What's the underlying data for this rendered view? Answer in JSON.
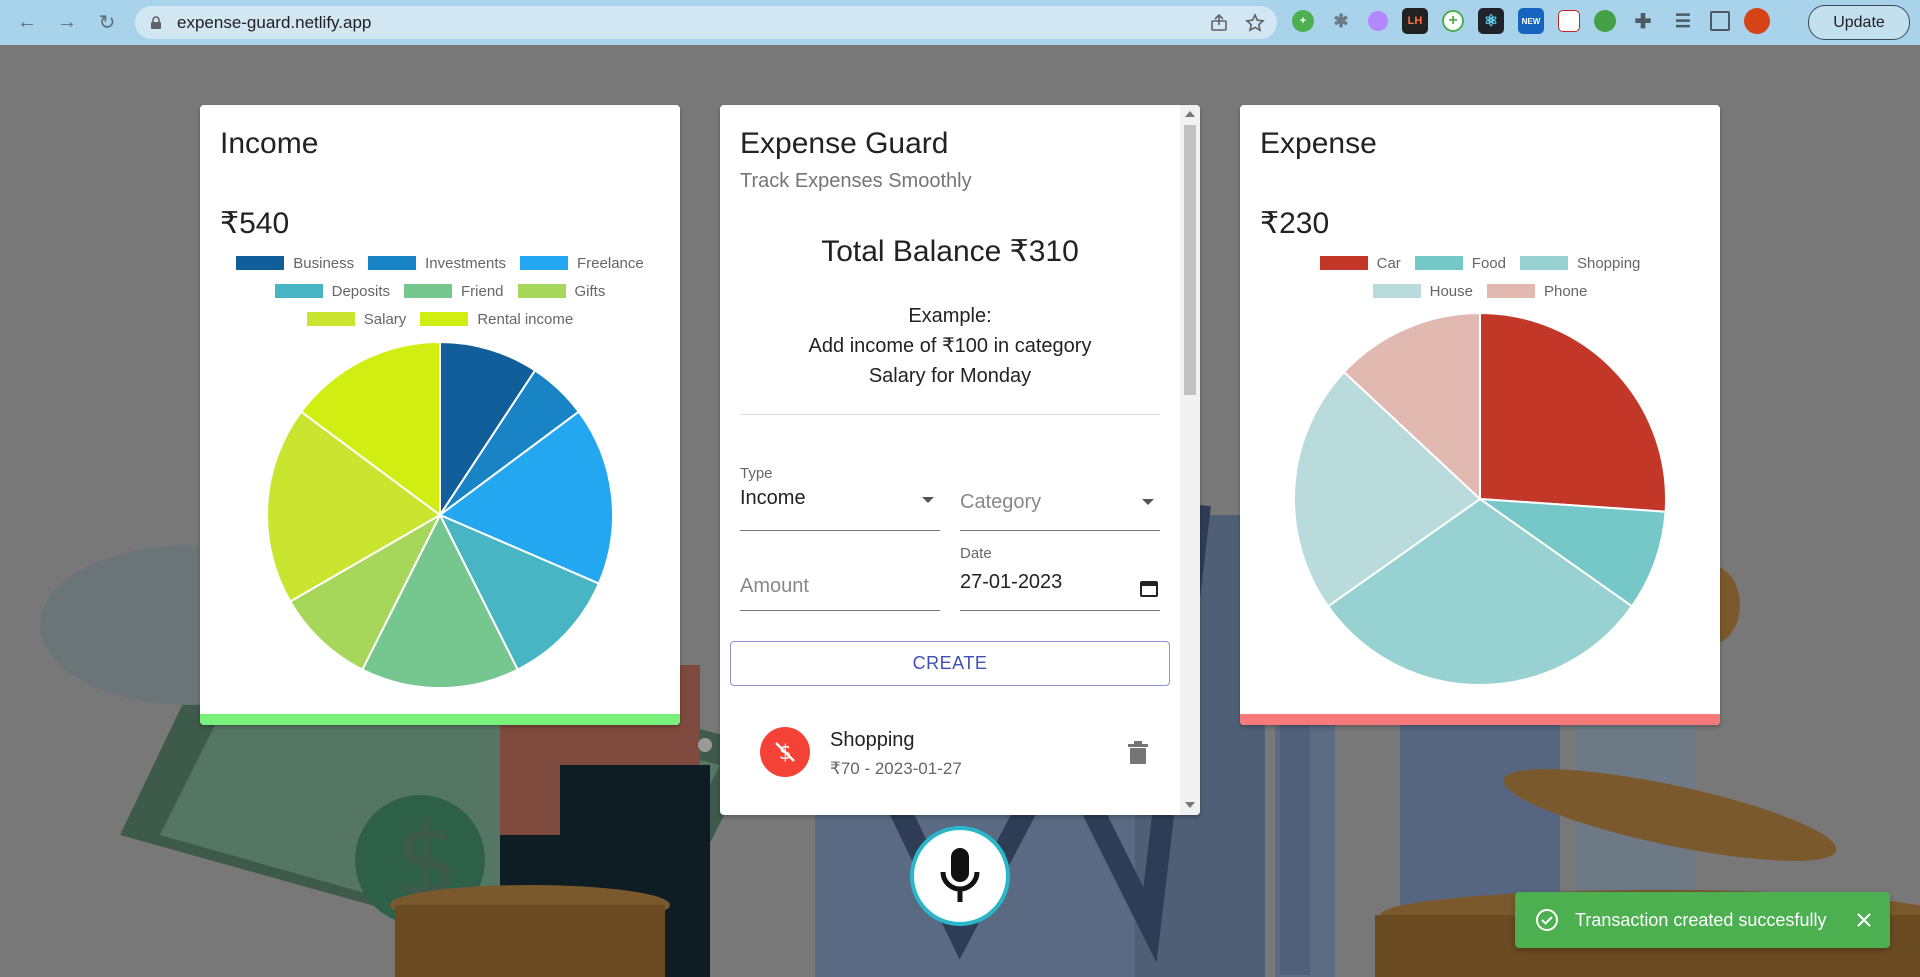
{
  "browser": {
    "url": "expense-guard.netlify.app",
    "update_label": "Update",
    "ext_lh": "LH",
    "ext_new": "NEW"
  },
  "income": {
    "title": "Income",
    "amount": "₹540",
    "legend_rows": [
      [
        {
          "label": "Business",
          "color": "#115f9a"
        },
        {
          "label": "Investments",
          "color": "#1984c5"
        },
        {
          "label": "Freelance",
          "color": "#22a7f0"
        }
      ],
      [
        {
          "label": "Deposits",
          "color": "#48b5c4"
        },
        {
          "label": "Friend",
          "color": "#76c68f"
        },
        {
          "label": "Gifts",
          "color": "#a6d75b"
        }
      ],
      [
        {
          "label": "Salary",
          "color": "#c9e52f"
        },
        {
          "label": "Rental income",
          "color": "#d0ee11"
        }
      ]
    ],
    "bar_color": "#77f17b"
  },
  "expense": {
    "title": "Expense",
    "amount": "₹230",
    "legend_rows": [
      [
        {
          "label": "Car",
          "color": "#c23728"
        },
        {
          "label": "Food",
          "color": "#76c8c8"
        },
        {
          "label": "Shopping",
          "color": "#98d1d1"
        }
      ],
      [
        {
          "label": "House",
          "color": "#badbdb"
        },
        {
          "label": "Phone",
          "color": "#e1b9b0"
        }
      ]
    ],
    "bar_color": "#f77a7a"
  },
  "main": {
    "title": "Expense Guard",
    "subtitle": "Track Expenses Smoothly",
    "balance": "Total Balance ₹310",
    "example_line1": "Example:",
    "example_line2": "Add income of ₹100 in category",
    "example_line3": "Salary for Monday",
    "type_label": "Type",
    "type_value": "Income",
    "category_placeholder": "Category",
    "amount_placeholder": "Amount",
    "date_label": "Date",
    "date_value": "27-01-2023",
    "create_label": "CREATE",
    "transactions": [
      {
        "name": "Shopping",
        "detail": "₹70 - 2023-01-27"
      }
    ]
  },
  "toast": {
    "message": "Transaction created succesfully",
    "color": "#4caf50"
  },
  "chart_data": [
    {
      "type": "pie",
      "title": "",
      "categories": [
        "Business",
        "Investments",
        "Freelance",
        "Deposits",
        "Friend",
        "Gifts",
        "Salary",
        "Rental income"
      ],
      "values": [
        50,
        30,
        90,
        60,
        80,
        50,
        100,
        80
      ],
      "colors": [
        "#115f9a",
        "#1984c5",
        "#22a7f0",
        "#48b5c4",
        "#76c68f",
        "#a6d75b",
        "#c9e52f",
        "#d0ee11"
      ]
    },
    {
      "type": "pie",
      "title": "",
      "categories": [
        "Car",
        "Food",
        "Shopping",
        "House",
        "Phone"
      ],
      "values": [
        60,
        20,
        70,
        50,
        30
      ],
      "colors": [
        "#c23728",
        "#76c8c8",
        "#98d1d1",
        "#badbdb",
        "#e1b9b0"
      ]
    }
  ]
}
